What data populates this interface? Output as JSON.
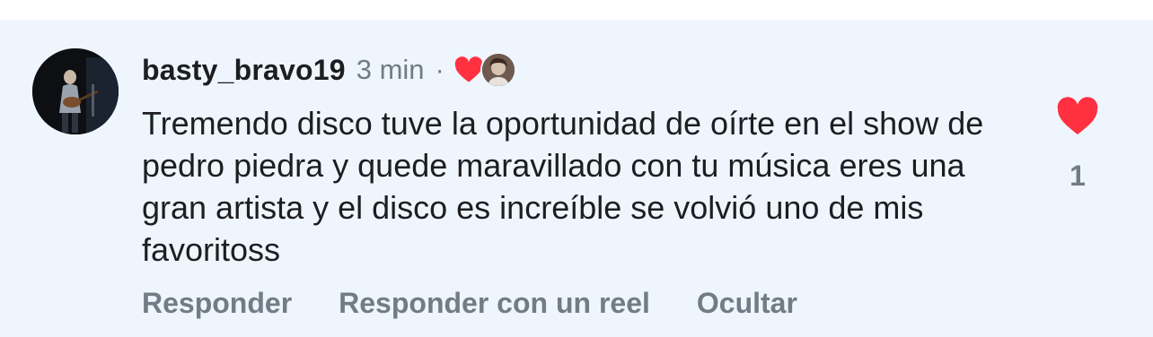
{
  "comment": {
    "username": "basty_bravo19",
    "time": "3 min",
    "separator": "·",
    "text": "Tremendo disco tuve la oportunidad de oírte en el show de pedro piedra y quede maravillado con tu música eres una gran artista y el disco es increíble se volvió uno de mis favoritoss",
    "like_count": "1",
    "liked": true,
    "liked_by_creator": true
  },
  "actions": {
    "reply": "Responder",
    "reply_reel": "Responder con un reel",
    "hide": "Ocultar"
  },
  "colors": {
    "background": "#eff5fd",
    "heart": "#ff3040",
    "text": "#1c1e21",
    "secondary": "#737b85"
  }
}
